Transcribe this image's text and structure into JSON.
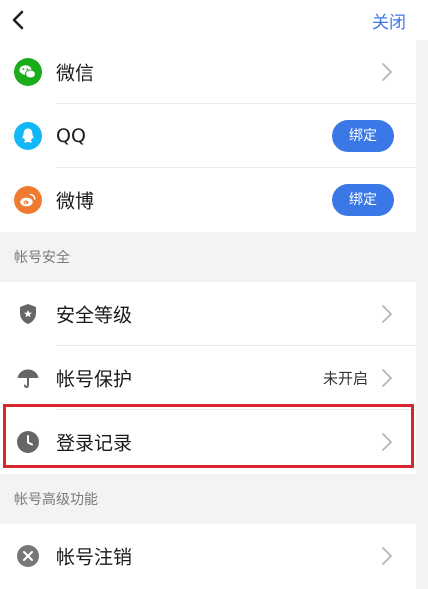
{
  "header": {
    "close_label": "关闭"
  },
  "third_party": [
    {
      "label": "微信",
      "icon": "wechat-icon",
      "color": "#1aad19",
      "action": "chevron"
    },
    {
      "label": "QQ",
      "icon": "qq-icon",
      "color": "#12b7f5",
      "action": "bind",
      "button": "绑定"
    },
    {
      "label": "微博",
      "icon": "weibo-icon",
      "color": "#f07a30",
      "action": "bind",
      "button": "绑定"
    }
  ],
  "sections": {
    "security_title": "帐号安全",
    "advanced_title": "帐号高级功能"
  },
  "security": [
    {
      "label": "安全等级",
      "icon": "shield-icon"
    },
    {
      "label": "帐号保护",
      "icon": "umbrella-icon",
      "status": "未开启"
    },
    {
      "label": "登录记录",
      "icon": "clock-icon"
    }
  ],
  "advanced": [
    {
      "label": "帐号注销",
      "icon": "cancel-account-icon"
    }
  ],
  "colors": {
    "accent": "#3b78e7",
    "highlight": "#d8262e"
  }
}
